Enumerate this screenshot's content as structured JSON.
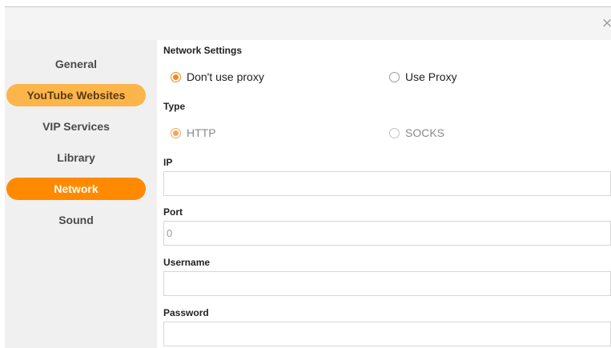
{
  "window": {
    "close_glyph": "×"
  },
  "sidebar": {
    "items": [
      {
        "label": "General",
        "state": "normal"
      },
      {
        "label": "YouTube Websites",
        "state": "highlight"
      },
      {
        "label": "VIP Services",
        "state": "normal"
      },
      {
        "label": "Library",
        "state": "normal"
      },
      {
        "label": "Network",
        "state": "active"
      },
      {
        "label": "Sound",
        "state": "normal"
      }
    ]
  },
  "network": {
    "section_title": "Network Settings",
    "proxy_options": {
      "none_label": "Don't use proxy",
      "use_label": "Use Proxy",
      "selected": "Don't use proxy"
    },
    "type_label": "Type",
    "type_options": {
      "http_label": "HTTP",
      "socks_label": "SOCKS",
      "selected": "HTTP",
      "disabled": true
    },
    "ip": {
      "label": "IP",
      "value": ""
    },
    "port": {
      "label": "Port",
      "value": "0"
    },
    "username": {
      "label": "Username",
      "value": ""
    },
    "password": {
      "label": "Password",
      "value": ""
    }
  },
  "colors": {
    "accent": "#ff8a00",
    "accent_light": "#fbb54a"
  }
}
